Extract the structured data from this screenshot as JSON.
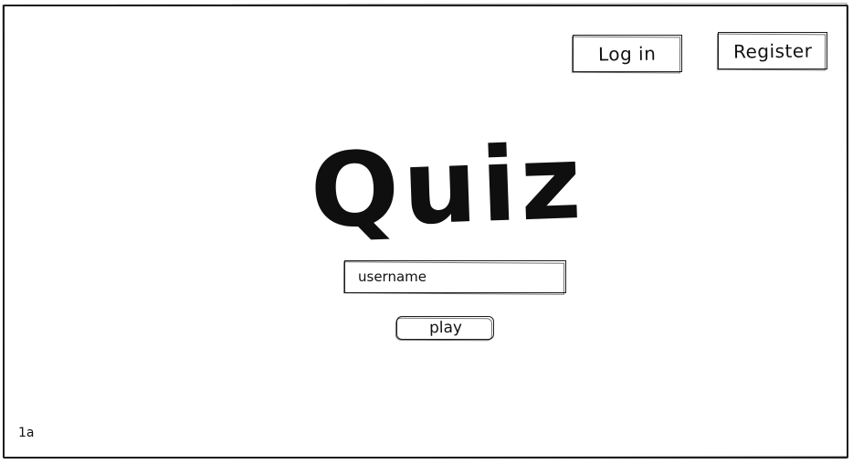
{
  "header": {
    "login_label": "Log in",
    "register_label": "Register"
  },
  "main": {
    "title": "Quiz",
    "username_placeholder": "username",
    "play_label": "play"
  },
  "footer": {
    "screen_id": "1a"
  }
}
